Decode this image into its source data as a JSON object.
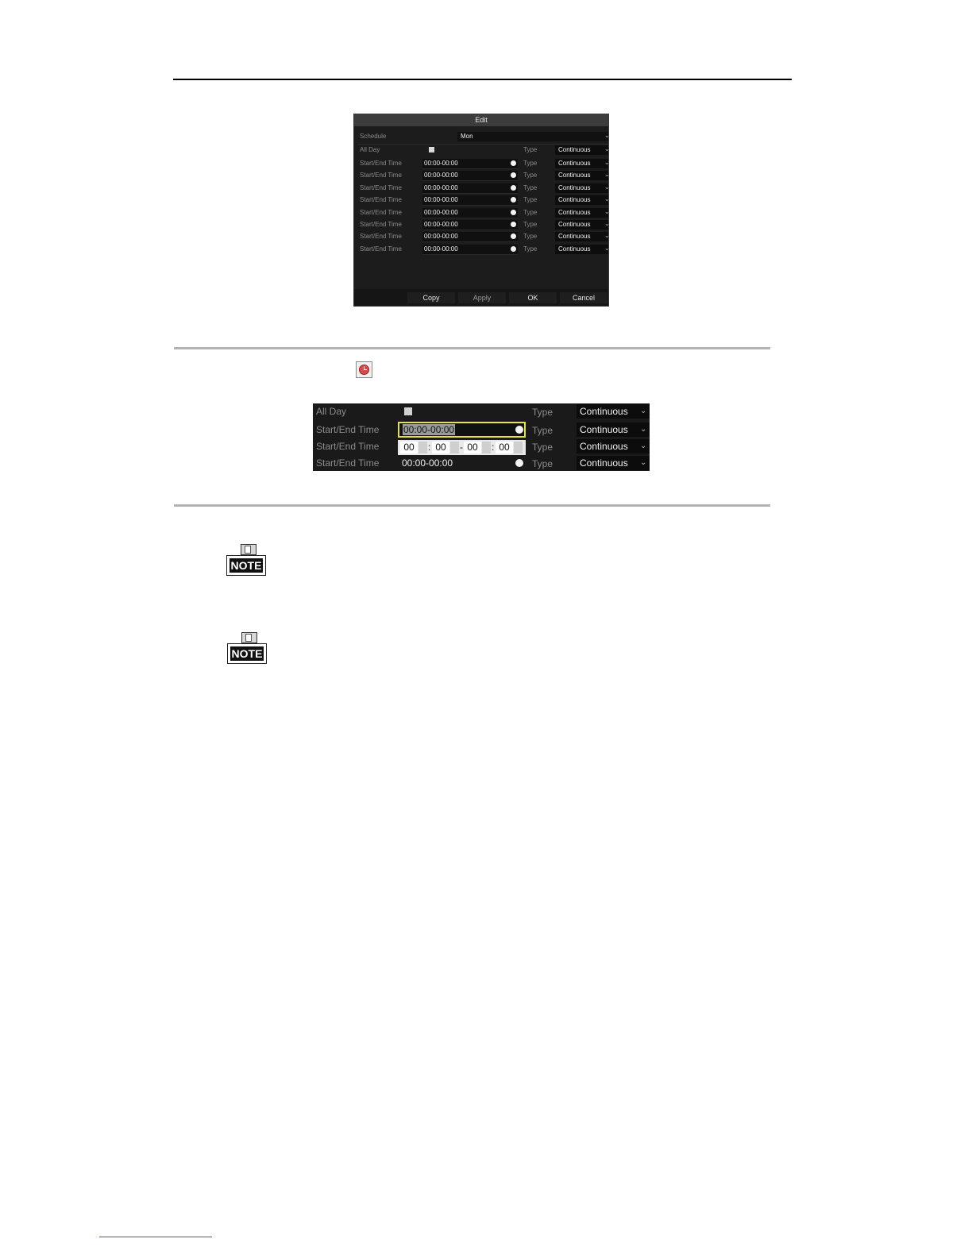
{
  "edit_dialog": {
    "title": "Edit",
    "schedule": {
      "label": "Schedule",
      "value": "Mon"
    },
    "all_day": {
      "label": "All Day",
      "type_label": "Type",
      "type_value": "Continuous"
    },
    "periods": [
      {
        "label": "Start/End Time",
        "value": "00:00-00:00",
        "type_label": "Type",
        "type_value": "Continuous"
      },
      {
        "label": "Start/End Time",
        "value": "00:00-00:00",
        "type_label": "Type",
        "type_value": "Continuous"
      },
      {
        "label": "Start/End Time",
        "value": "00:00-00:00",
        "type_label": "Type",
        "type_value": "Continuous"
      },
      {
        "label": "Start/End Time",
        "value": "00:00-00:00",
        "type_label": "Type",
        "type_value": "Continuous"
      },
      {
        "label": "Start/End Time",
        "value": "00:00-00:00",
        "type_label": "Type",
        "type_value": "Continuous"
      },
      {
        "label": "Start/End Time",
        "value": "00:00-00:00",
        "type_label": "Type",
        "type_value": "Continuous"
      },
      {
        "label": "Start/End Time",
        "value": "00:00-00:00",
        "type_label": "Type",
        "type_value": "Continuous"
      },
      {
        "label": "Start/End Time",
        "value": "00:00-00:00",
        "type_label": "Type",
        "type_value": "Continuous"
      }
    ],
    "buttons": {
      "copy": "Copy",
      "apply": "Apply",
      "ok": "OK",
      "cancel": "Cancel"
    }
  },
  "zoom_panel": {
    "all_day": {
      "label": "All Day",
      "type_label": "Type",
      "type_value": "Continuous"
    },
    "row1": {
      "label": "Start/End Time",
      "value": "00:00-00:00",
      "type_label": "Type",
      "type_value": "Continuous"
    },
    "row2": {
      "label": "Start/End Time",
      "h1": "00",
      "m1": "00",
      "h2": "00",
      "m2": "00",
      "colon": ":",
      "dash": "-",
      "type_label": "Type",
      "type_value": "Continuous"
    },
    "row3": {
      "label": "Start/End Time",
      "value": "00:00-00:00",
      "type_label": "Type",
      "type_value": "Continuous"
    }
  },
  "notes": [
    {
      "label": "NOTE"
    },
    {
      "label": "NOTE"
    }
  ],
  "colors": {
    "highlight_border": "#e4e43a",
    "dialog_bg": "#1c1c1c",
    "clock_red": "#d84a4a"
  }
}
